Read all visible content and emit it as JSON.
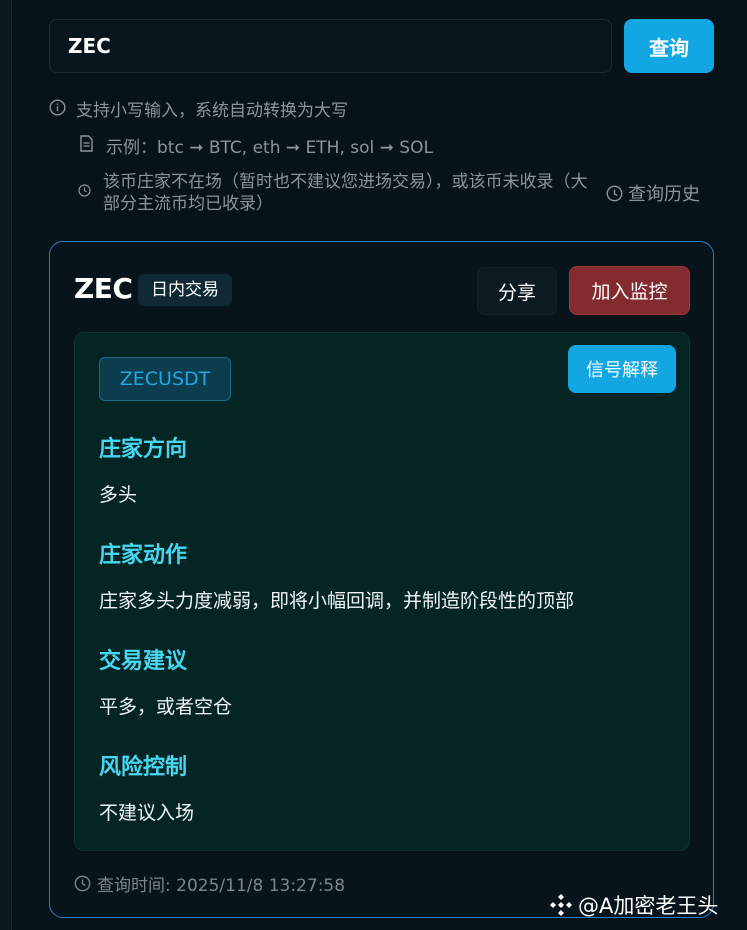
{
  "search": {
    "value": "ZEC",
    "button_label": "查询"
  },
  "hints": {
    "line1": "支持小写输入，系统自动转换为大写",
    "line2": "示例：btc ➞ BTC, eth ➞ ETH, sol ➞ SOL",
    "line3": "该币庄家不在场（暂时也不建议您进场交易），或该币未收录（大部分主流币均已收录）",
    "history_label": "查询历史"
  },
  "result": {
    "coin": "ZEC",
    "mode": "日内交易",
    "share_label": "分享",
    "monitor_label": "加入监控",
    "pair": "ZECUSDT",
    "explain_label": "信号解释",
    "sections": [
      {
        "heading": "庄家方向",
        "value": "多头"
      },
      {
        "heading": "庄家动作",
        "value": "庄家多头力度减弱，即将小幅回调，并制造阶段性的顶部"
      },
      {
        "heading": "交易建议",
        "value": "平多，或者空仓"
      },
      {
        "heading": "风险控制",
        "value": "不建议入场"
      }
    ],
    "query_time": "查询时间: 2025/11/8 13:27:58"
  },
  "watermark": "@A加密老王头",
  "colors": {
    "background": "#07131a",
    "accent": "#12a6e3",
    "danger": "#832b2f",
    "section_heading": "#47d8f0",
    "card_border": "#2f7fbf"
  }
}
